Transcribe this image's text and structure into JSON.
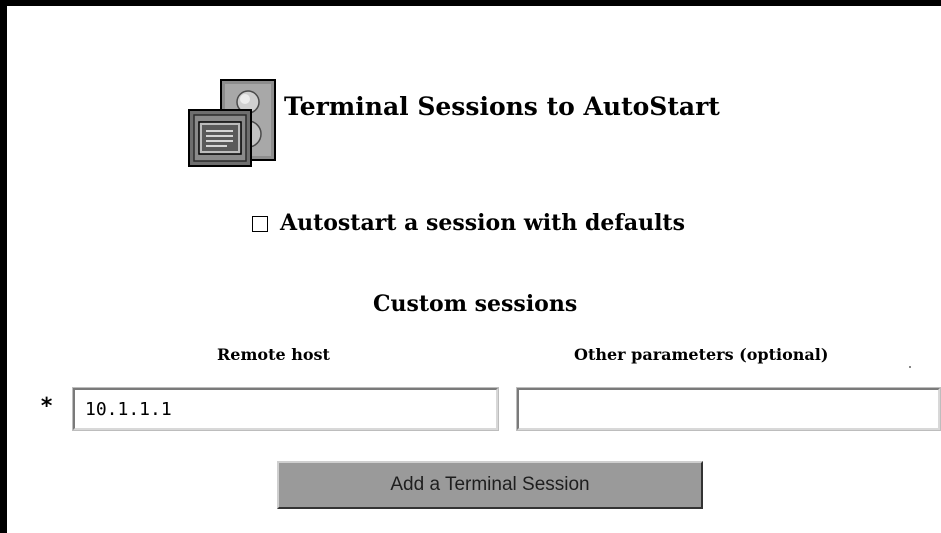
{
  "header": {
    "title": "Terminal Sessions to AutoStart",
    "icon": "terminal-sessions-icon"
  },
  "autostart": {
    "label": "Autostart a session with defaults",
    "checked": false
  },
  "custom_sessions": {
    "title": "Custom sessions",
    "columns": {
      "remote_host": "Remote host",
      "other_parameters": "Other parameters (optional)"
    },
    "required_marker": "*",
    "remote_host_value": "10.1.1.1",
    "other_parameters_value": ""
  },
  "actions": {
    "add_label": "Add a Terminal Session"
  },
  "colors": {
    "button_face": "#9a9a9a",
    "frame_border": "#000000"
  }
}
